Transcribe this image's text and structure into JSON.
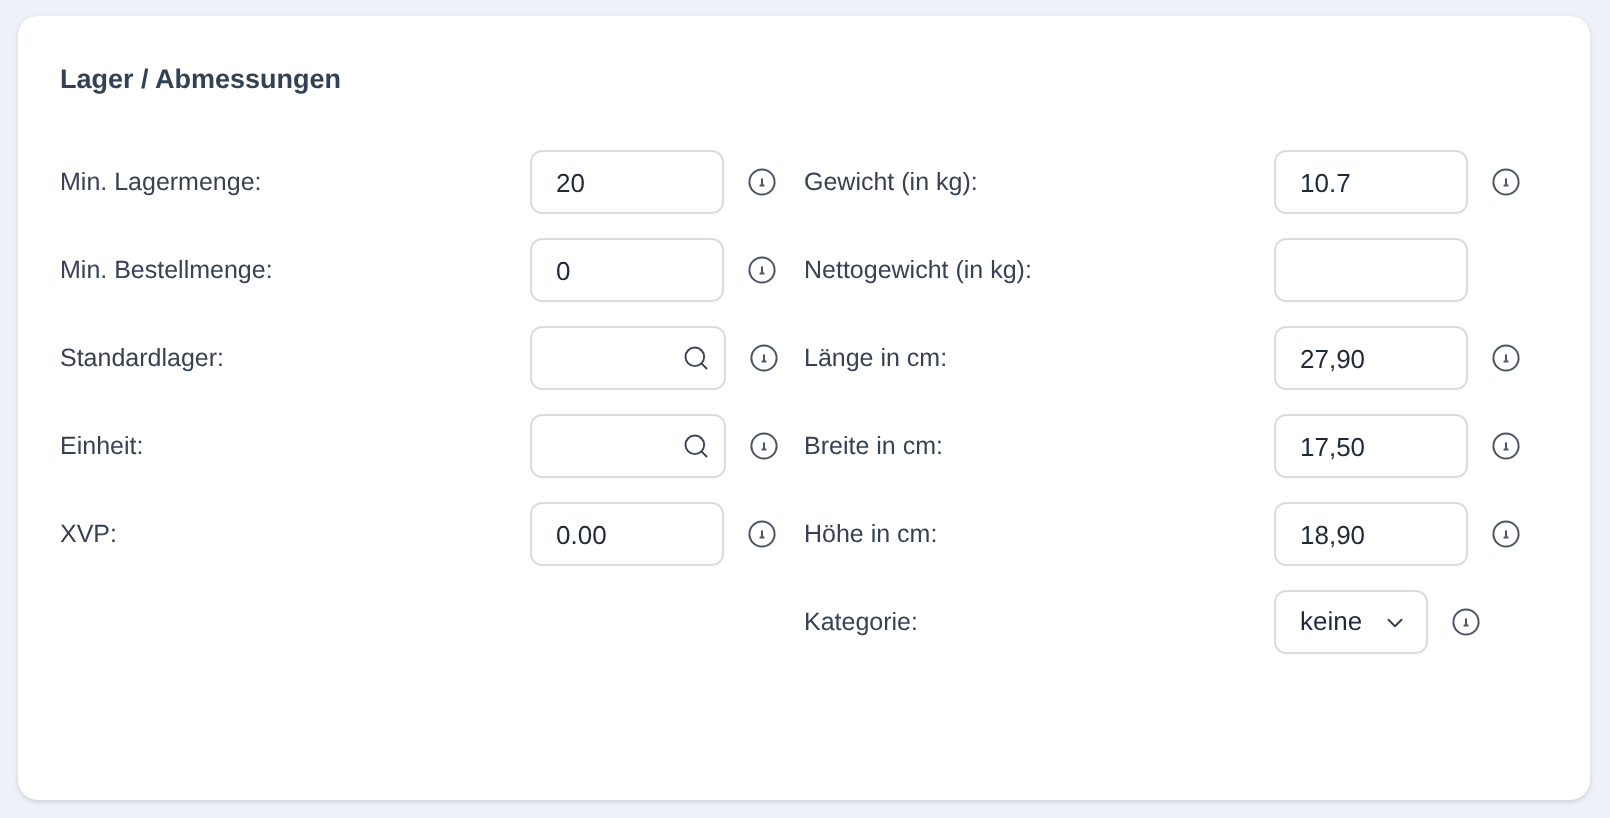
{
  "title": "Lager / Abmessungen",
  "columns": [
    {
      "fields": [
        {
          "label": "Min. Lagermenge:",
          "kind": "text",
          "value": "20",
          "info": true
        },
        {
          "label": "Min. Bestellmenge:",
          "kind": "text",
          "value": "0",
          "info": true
        },
        {
          "label": "Standardlager:",
          "kind": "search",
          "info": true
        },
        {
          "label": "Einheit:",
          "kind": "search",
          "info": true
        },
        {
          "label": "XVP:",
          "kind": "text",
          "value": "0.00",
          "info": true
        }
      ]
    },
    {
      "fields": [
        {
          "label": "Gewicht (in kg):",
          "kind": "text",
          "value": "10.7",
          "info": true
        },
        {
          "label": "Nettogewicht (in kg):",
          "kind": "text",
          "info": false
        },
        {
          "label": "Länge in cm:",
          "kind": "text",
          "value": "27,90",
          "info": true
        },
        {
          "label": "Breite in cm:",
          "kind": "text",
          "value": "17,50",
          "info": true
        },
        {
          "label": "Höhe in cm:",
          "kind": "text",
          "value": "18,90",
          "info": true
        },
        {
          "label": "Kategorie:",
          "kind": "select",
          "value": "keine",
          "info": true
        }
      ]
    }
  ]
}
